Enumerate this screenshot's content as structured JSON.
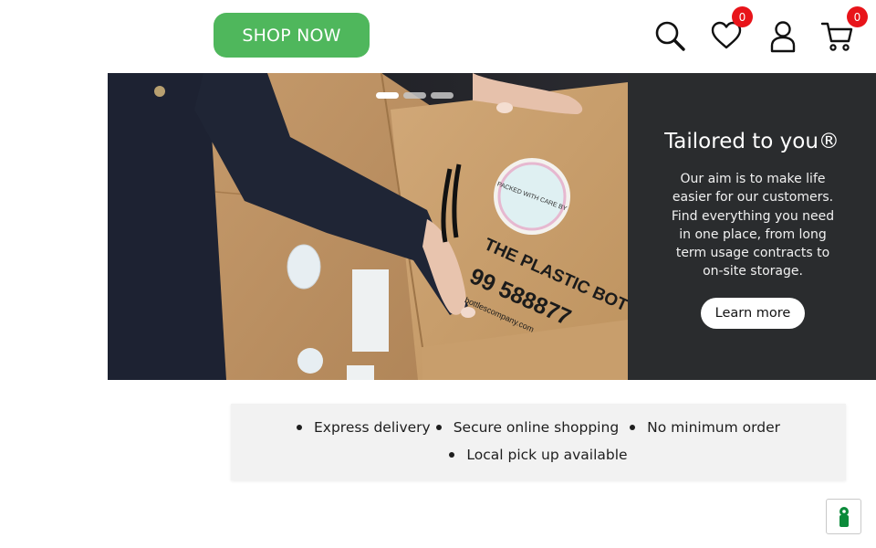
{
  "header": {
    "shop_now_label": "SHOP NOW",
    "wishlist_count": "0",
    "cart_count": "0",
    "icons": [
      "search-icon",
      "heart-icon",
      "user-icon",
      "cart-icon"
    ]
  },
  "hero": {
    "title": "Tailored to you®",
    "text": "Our aim is to make life easier for our customers. Find everything you need in one place, from long term usage contracts to on-site storage.",
    "button_label": "Learn more",
    "slides": 3,
    "active_slide": 1,
    "sticker_text": "PACKED WITH CARE BY",
    "box_brand": "THE PLASTIC BOTTLES CO.",
    "box_phone": "99 588877",
    "box_website": "bottlescompany.com"
  },
  "features": [
    "Express delivery",
    "Secure online shopping",
    "No minimum order",
    "Local pick up available"
  ],
  "colors": {
    "brand_green": "#4fb75c",
    "badge_red": "#e8141a",
    "panel_dark": "#2a2c2e",
    "feature_bg": "#f2f2f2"
  }
}
